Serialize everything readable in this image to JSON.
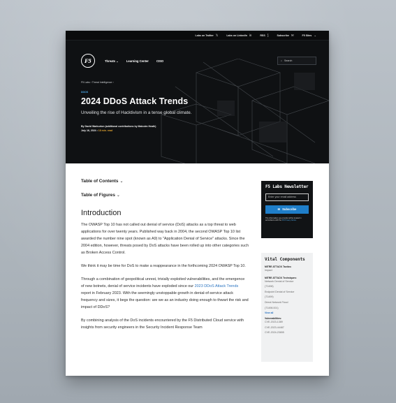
{
  "topbar": {
    "links": [
      {
        "label": "Labs on Twitter",
        "glyph": "𝕏"
      },
      {
        "label": "Labs on LinkedIn",
        "glyph": "in"
      },
      {
        "label": "RSS",
        "glyph": "⟆"
      },
      {
        "label": "Subscribe",
        "glyph": "✉"
      },
      {
        "label": "F5 Sites",
        "glyph": "⌄"
      }
    ]
  },
  "nav": {
    "logo": "F5",
    "items": [
      "Threats ⌄",
      "Learning Center",
      "CISO"
    ],
    "search_placeholder": "Search"
  },
  "hero": {
    "breadcrumb": "F5 Labs › Threat Intelligence ›",
    "tag": "DDOS",
    "title": "2024 DDoS Attack Trends",
    "subtitle": "Unveiling the rise of Hacktivism in a tense global climate.",
    "byline": "By David Warburton (additional contributions by Malcolm Heath)",
    "date": "July 16, 2024",
    "read_time": "18 min. read"
  },
  "body": {
    "toc": "Table of Contents",
    "tof": "Table of Figures",
    "intro_heading": "Introduction",
    "p1": "The OWASP Top 10 has not called out denial of service (DoS) attacks as a top threat to web applications for over twenty years. Published way back in 2004, the second OWASP Top 10 list awarded the number nine spot (known as A9) to \"Application Denial of Service\" attacks. Since the 2004 edition, however, threats posed by DoS attacks have been rolled up into other categories such as Broken Access Control.",
    "p2": "We think it may be time for DoS to make a reappearance in the forthcoming 2024 OWASP Top 10.",
    "p3_before": "Through a combination of geopolitical unrest, trivially exploited vulnerabilities, and the emergence of new botnets, denial of service incidents have exploded since our ",
    "p3_link": "2023 DDoS Attack Trends",
    "p3_after": " report in February 2023. With the seemingly unstoppable growth in denial-of-service attack frequency and sizes, it begs the question: are we as an industry doing enough to thwart the risk and impact of DDoS?",
    "p4": "By combining analysis of the DoS incidents encountered by the F5 Distributed Cloud service with insights from security engineers in the Security Incident Response Team"
  },
  "newsletter": {
    "title": "F5 Labs Newsletter",
    "input_placeholder": "Enter your email address",
    "button": "Subscribe",
    "note": "The information you provide will be treated in accordance with the",
    "note_link": "F5 Privacy Notice"
  },
  "vital": {
    "title": "Vital Components",
    "tactics_label": "MITRE ATT&CK Tactics:",
    "tactics": [
      "Impact"
    ],
    "techniques_label": "MITRE ATT&CK Techniques:",
    "techniques": [
      "Network Denial of Service",
      "(T1498)",
      "Endpoint Denial of Service",
      "(T1499)",
      "Direct Network Flood",
      "(T1498.001)"
    ],
    "view_all": "View all",
    "vulns_label": "Vulnerabilities:",
    "vulns": [
      "CVE-2023-1389",
      "CVE-2023-44487",
      "CVE-2024-23655"
    ]
  },
  "colors": {
    "hero_bg": "#0f1113",
    "accent_blue": "#1f7ec9",
    "link_blue": "#2b74c0",
    "read_time_orange": "#e0a431"
  }
}
